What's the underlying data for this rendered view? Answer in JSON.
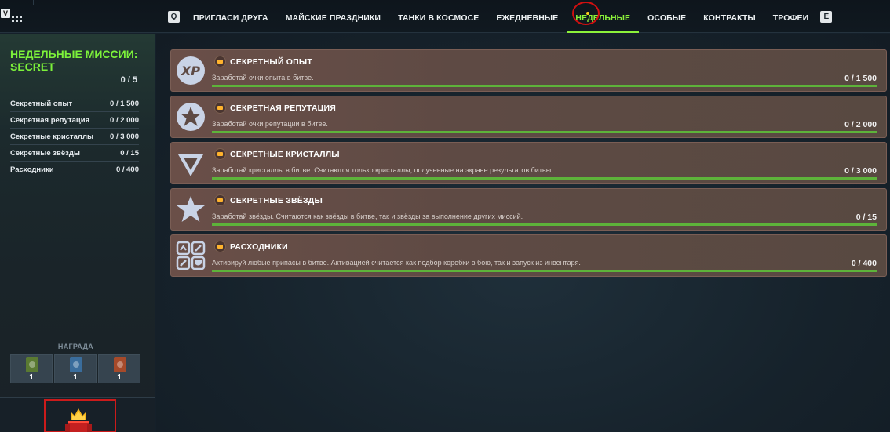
{
  "top_bar": {
    "left_key": "V",
    "nav_key_left": "Q",
    "nav_key_right": "E",
    "tabs": [
      {
        "label": "ПРИГЛАСИ ДРУГА",
        "active": false
      },
      {
        "label": "МАЙСКИЕ ПРАЗДНИКИ",
        "active": false
      },
      {
        "label": "ТАНКИ В КОСМОСЕ",
        "active": false
      },
      {
        "label": "ЕЖЕДНЕВНЫЕ",
        "active": false
      },
      {
        "label": "НЕДЕЛЬНЫЕ",
        "active": true
      },
      {
        "label": "ОСОБЫЕ",
        "active": false
      },
      {
        "label": "КОНТРАКТЫ",
        "active": false
      },
      {
        "label": "ТРОФЕИ",
        "active": false
      }
    ]
  },
  "sidebar": {
    "title": "НЕДЕЛЬНЫЕ МИССИИ: SECRET",
    "total": "0 / 5",
    "items": [
      {
        "label": "Секретный опыт",
        "value": "0 / 1 500"
      },
      {
        "label": "Секретная репутация",
        "value": "0 / 2 000"
      },
      {
        "label": "Секретные кристаллы",
        "value": "0 / 3 000"
      },
      {
        "label": "Секретные звёзды",
        "value": "0 / 15"
      },
      {
        "label": "Расходники",
        "value": "0 / 400"
      }
    ],
    "reward_label": "НАГРАДА",
    "rewards": [
      {
        "qty": "1",
        "color": "#5a7a32"
      },
      {
        "qty": "1",
        "color": "#3a6d9c"
      },
      {
        "qty": "1",
        "color": "#a64a2a"
      }
    ]
  },
  "missions": [
    {
      "icon": "xp-icon",
      "title": "СЕКРЕТНЫЙ ОПЫТ",
      "desc": "Заработай очки опыта в битве.",
      "progress": "0 / 1 500"
    },
    {
      "icon": "reputation-star-icon",
      "title": "СЕКРЕТНАЯ РЕПУТАЦИЯ",
      "desc": "Заработай очки репутации в битве.",
      "progress": "0 / 2 000"
    },
    {
      "icon": "crystal-icon",
      "title": "СЕКРЕТНЫЕ КРИСТАЛЛЫ",
      "desc": "Заработай кристаллы в битве. Считаются только кристаллы, полученные на экране результатов битвы.",
      "progress": "0 / 3 000"
    },
    {
      "icon": "star-icon",
      "title": "СЕКРЕТНЫЕ ЗВЁЗДЫ",
      "desc": "Заработай звёзды. Считаются как звёзды в битве, так и звёзды за выполнение других миссий.",
      "progress": "0 / 15"
    },
    {
      "icon": "supplies-icon",
      "title": "РАСХОДНИКИ",
      "desc": "Активируй любые припасы в битве. Активацией считается как подбор коробки в бою, так и запуск из инвентаря.",
      "progress": "0 / 400"
    }
  ],
  "colors": {
    "accent_green": "#8cf23a",
    "annotation_red": "#d01010",
    "notification_dot": "#ffd21a"
  }
}
